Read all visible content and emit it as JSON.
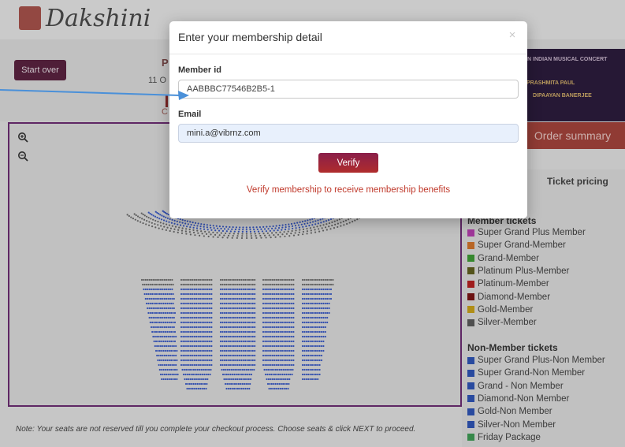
{
  "brand": {
    "logo_text": "Dakshini"
  },
  "header": {
    "start_over_label": "Start over",
    "peek_initial": "P",
    "peek_date": "11 O",
    "peek_c": "C"
  },
  "banner": {
    "line1": "AN INDIAN MUSICAL CONCERT",
    "line2": "PRASHMITA PAUL",
    "line3": "DIPAAYAN BANERJEE"
  },
  "seating": {
    "zoom_in_icon": "zoom-in-icon",
    "zoom_out_icon": "zoom-out-icon"
  },
  "order_summary_label": "Order summary",
  "pricing": {
    "title": "Ticket pricing",
    "member_heading": "Member tickets",
    "member_items": [
      {
        "label": "Super Grand Plus Member",
        "color": "#b73fb0"
      },
      {
        "label": "Super Grand-Member",
        "color": "#d2752c"
      },
      {
        "label": "Grand-Member",
        "color": "#3e9b35"
      },
      {
        "label": "Platinum Plus-Member",
        "color": "#5f5f1f"
      },
      {
        "label": "Platinum-Member",
        "color": "#b52121"
      },
      {
        "label": "Diamond-Member",
        "color": "#7a1515"
      },
      {
        "label": "Gold-Member",
        "color": "#c9a21b"
      },
      {
        "label": "Silver-Member",
        "color": "#5a5a5a"
      }
    ],
    "nonmember_heading": "Non-Member tickets",
    "nonmember_items": [
      {
        "label": "Super Grand Plus-Non Member",
        "color": "#2f55b5"
      },
      {
        "label": "Super Grand-Non Member",
        "color": "#2f55b5"
      },
      {
        "label": "Grand - Non Member",
        "color": "#2f55b5"
      },
      {
        "label": "Diamond-Non Member",
        "color": "#2f55b5"
      },
      {
        "label": "Gold-Non Member",
        "color": "#2f55b5"
      },
      {
        "label": "Silver-Non Member",
        "color": "#2f55b5"
      },
      {
        "label": "Friday Package",
        "color": "#3e9b55"
      }
    ]
  },
  "note": "Note: Your seats are not reserved till you complete your checkout process. Choose seats & click NEXT to proceed.",
  "modal": {
    "title": "Enter your membership detail",
    "close_glyph": "×",
    "member_id_label": "Member id",
    "member_id_value": "AABBBC77546B2B5-1",
    "email_label": "Email",
    "email_value": "mini.a@vibrnz.com",
    "verify_label": "Verify",
    "verify_note": "Verify membership to receive membership benefits"
  },
  "colors": {
    "accent": "#8a1f4a",
    "error_text": "#c0392b",
    "pointer_arrow": "#4a90d9"
  }
}
